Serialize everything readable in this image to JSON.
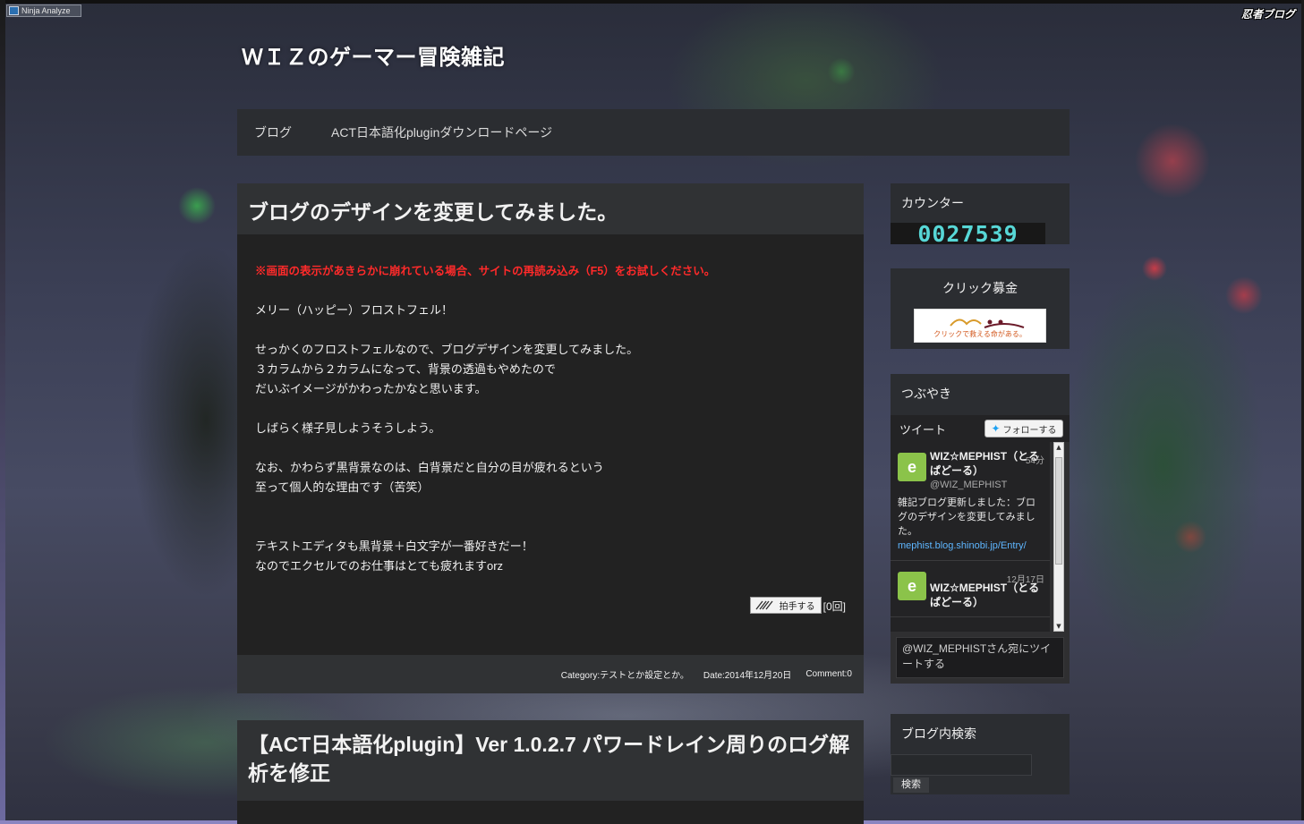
{
  "ninja_badge": "Ninja Analyze",
  "shinobi_logo": "忍者ブログ",
  "site": {
    "title": "ＷＩＺのゲーマー冒険雑記"
  },
  "nav": {
    "items": [
      {
        "label": "ブログ"
      },
      {
        "label": "ACT日本語化pluginダウンロードページ"
      }
    ]
  },
  "posts": [
    {
      "title": "ブログのデザインを変更してみました。",
      "notice": "※画面の表示があきらかに崩れている場合、サイトの再読み込み（F5）をお試しください。",
      "lines": [
        "",
        "メリー（ハッピー）フロストフェル！",
        "",
        "せっかくのフロストフェルなので、ブログデザインを変更してみました。",
        "３カラムから２カラムになって、背景の透過もやめたので",
        "だいぶイメージがかわったかなと思います。",
        "",
        "しばらく様子見しようそうしよう。",
        "",
        "なお、かわらず黒背景なのは、白背景だと自分の目が疲れるという",
        "至って個人的な理由です（苦笑）",
        "",
        "",
        "テキストエディタも黒背景＋白文字が一番好きだー！",
        "なのでエクセルでのお仕事はとても疲れますorz"
      ],
      "clap_label": "拍手する",
      "clap_count": "[0回]",
      "category": "Category:テストとか設定とか。",
      "date": "Date:2014年12月20日",
      "comment": "Comment:0"
    },
    {
      "title": "【ACT日本語化plugin】Ver 1.0.2.7 パワードレイン周りのログ解析を修正"
    }
  ],
  "sidebar": {
    "counter": {
      "title": "カウンター",
      "value": "0027539"
    },
    "donate": {
      "title": "クリック募金",
      "banner_text": "クリックで救える命がある。"
    },
    "tweets": {
      "title": "つぶやき",
      "header_label": "ツイート",
      "follow_label": "フォローする",
      "items": [
        {
          "name": "WIZ☆MEPHIST（とるぱどーる）",
          "time": "54分",
          "handle": "@WIZ_MEPHIST",
          "text": "雑記ブログ更新しました：ブログのデザインを変更してみました。",
          "link": "mephist.blog.shinobi.jp/Entry/"
        },
        {
          "name": "WIZ☆MEPHIST（とるぱどーる）",
          "time": "12月17日",
          "handle": "",
          "text": "",
          "link": ""
        }
      ],
      "compose_placeholder": "@WIZ_MEPHISTさん宛にツイートする"
    },
    "search": {
      "title": "ブログ内検索",
      "button_label": "検索"
    }
  },
  "colors": {
    "panel": "#2b2d31",
    "post_bg": "#222222",
    "notice_red": "#ff2a2a",
    "counter_cyan": "#57d7d6",
    "link_blue": "#5eb6ff"
  }
}
